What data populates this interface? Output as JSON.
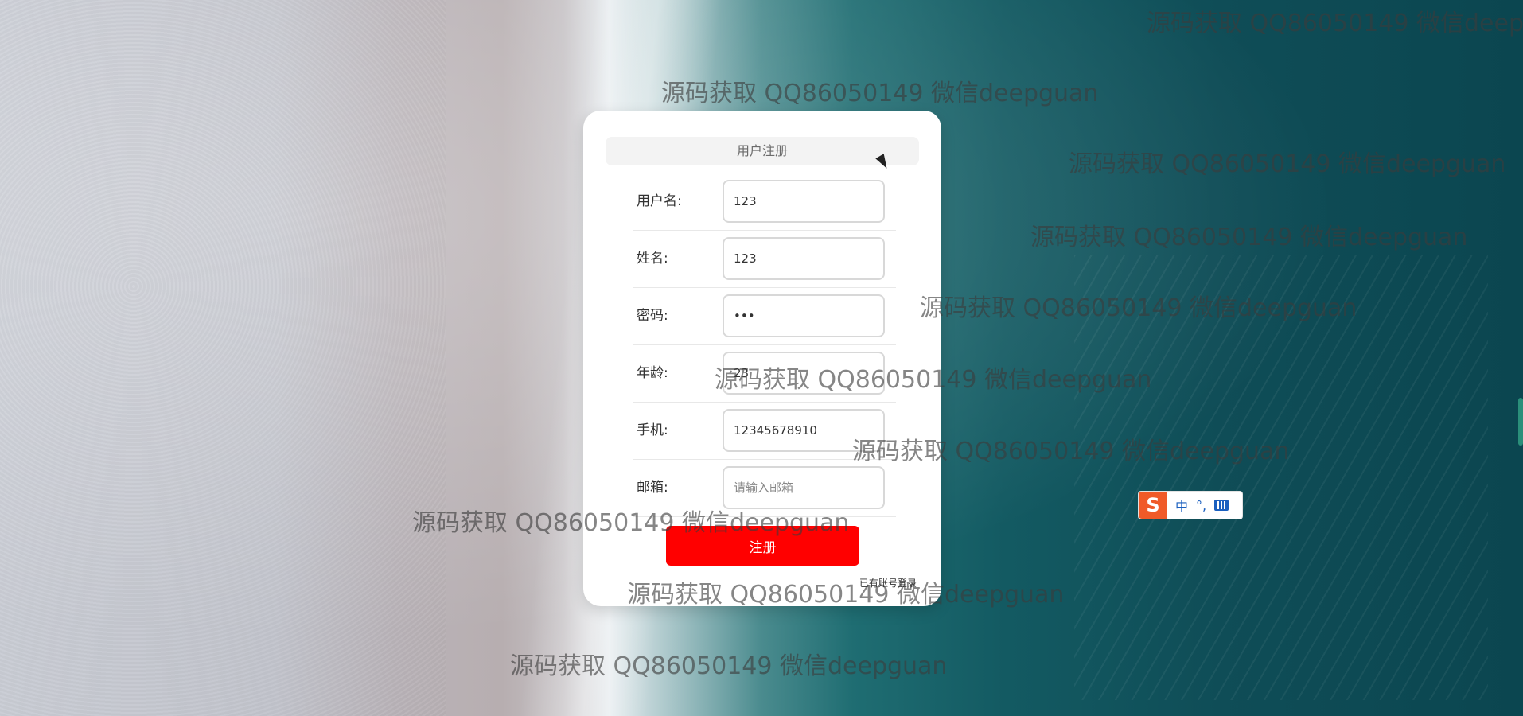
{
  "page": {
    "title": "用户注册"
  },
  "form": {
    "fields": [
      {
        "label": "用户名:",
        "value": "123",
        "placeholder": "",
        "type": "text"
      },
      {
        "label": "姓名:",
        "value": "123",
        "placeholder": "",
        "type": "text"
      },
      {
        "label": "密码:",
        "value": "123",
        "placeholder": "",
        "type": "password"
      },
      {
        "label": "年龄:",
        "value": "23",
        "placeholder": "",
        "type": "text"
      },
      {
        "label": "手机:",
        "value": "12345678910",
        "placeholder": "",
        "type": "text"
      },
      {
        "label": "邮箱:",
        "value": "",
        "placeholder": "请输入邮箱",
        "type": "text"
      }
    ],
    "submit_label": "注册",
    "login_link": "已有账号登录"
  },
  "watermark": {
    "text": "源码获取 QQ86050149 微信deepguan"
  },
  "ime": {
    "logo": "S",
    "mode": "中",
    "punct": "°,",
    "icons": [
      "sogou-logo-icon",
      "keyboard-icon"
    ]
  },
  "colors": {
    "accent": "#ff0000",
    "card": "#ffffff",
    "ime_blue": "#1a5fbf"
  }
}
